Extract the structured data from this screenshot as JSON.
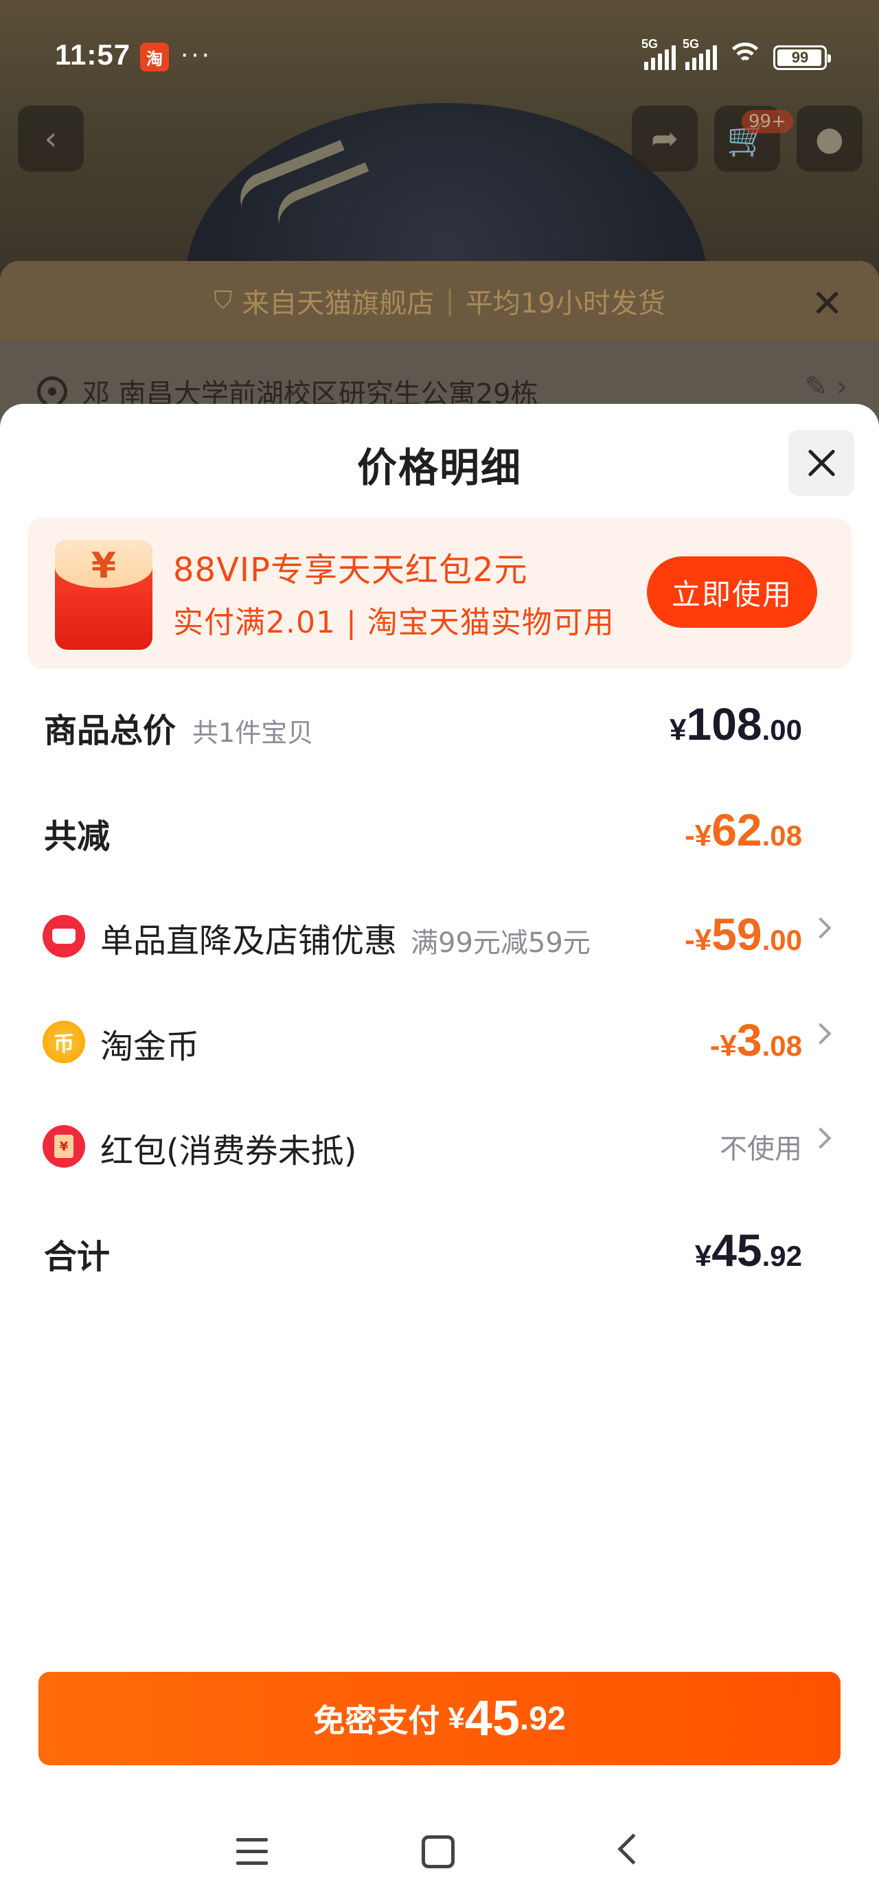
{
  "status_bar": {
    "time": "11:57",
    "app_icon_glyph": "淘",
    "dots": "···",
    "signal1_label": "5G",
    "signal2_label": "5G",
    "battery": "99"
  },
  "background": {
    "cart_badge": "99+",
    "banner_part1": "来自天猫旗舰店",
    "banner_part2": "平均19小时发货",
    "banner_sep": "|",
    "address": "邓 南昌大学前湖校区研究生公寓29栋"
  },
  "sheet": {
    "title": "价格明细",
    "promo": {
      "yen_glyph": "¥",
      "title": "88VIP专享天天红包2元",
      "subtitle": "实付满2.01 | 淘宝天猫实物可用",
      "button": "立即使用"
    },
    "rows": {
      "total": {
        "label": "商品总价",
        "sub": "共1件宝贝",
        "cur": "¥",
        "int": "108",
        "dec": ".00"
      },
      "discount": {
        "label": "共减",
        "cur": "-¥",
        "int": "62",
        "dec": ".08"
      },
      "shop": {
        "label": "单品直降及店铺优惠",
        "note": "满99元减59元",
        "cur": "-¥",
        "int": "59",
        "dec": ".00"
      },
      "coin": {
        "label": "淘金币",
        "icon_glyph": "币",
        "cur": "-¥",
        "int": "3",
        "dec": ".08"
      },
      "packet": {
        "label": "红包(消费券未抵)",
        "icon_glyph": "¥",
        "value": "不使用"
      },
      "sum": {
        "label": "合计",
        "cur": "¥",
        "int": "45",
        "dec": ".92"
      }
    },
    "pay_button": {
      "label": "免密支付",
      "cur": "¥",
      "int": "45",
      "dec": ".92"
    }
  },
  "colors": {
    "accent": "#ff5200",
    "discount": "#f26a1b",
    "promo_text": "#f04b17"
  },
  "icons": [
    "back-icon",
    "share-icon",
    "cart-icon",
    "message-icon",
    "shield-check-icon",
    "close-icon",
    "location-pin-icon",
    "edit-icon",
    "shop-icon",
    "coin-icon",
    "red-packet-icon",
    "chevron-right-icon",
    "menu-icon",
    "home-icon",
    "nav-back-icon"
  ]
}
